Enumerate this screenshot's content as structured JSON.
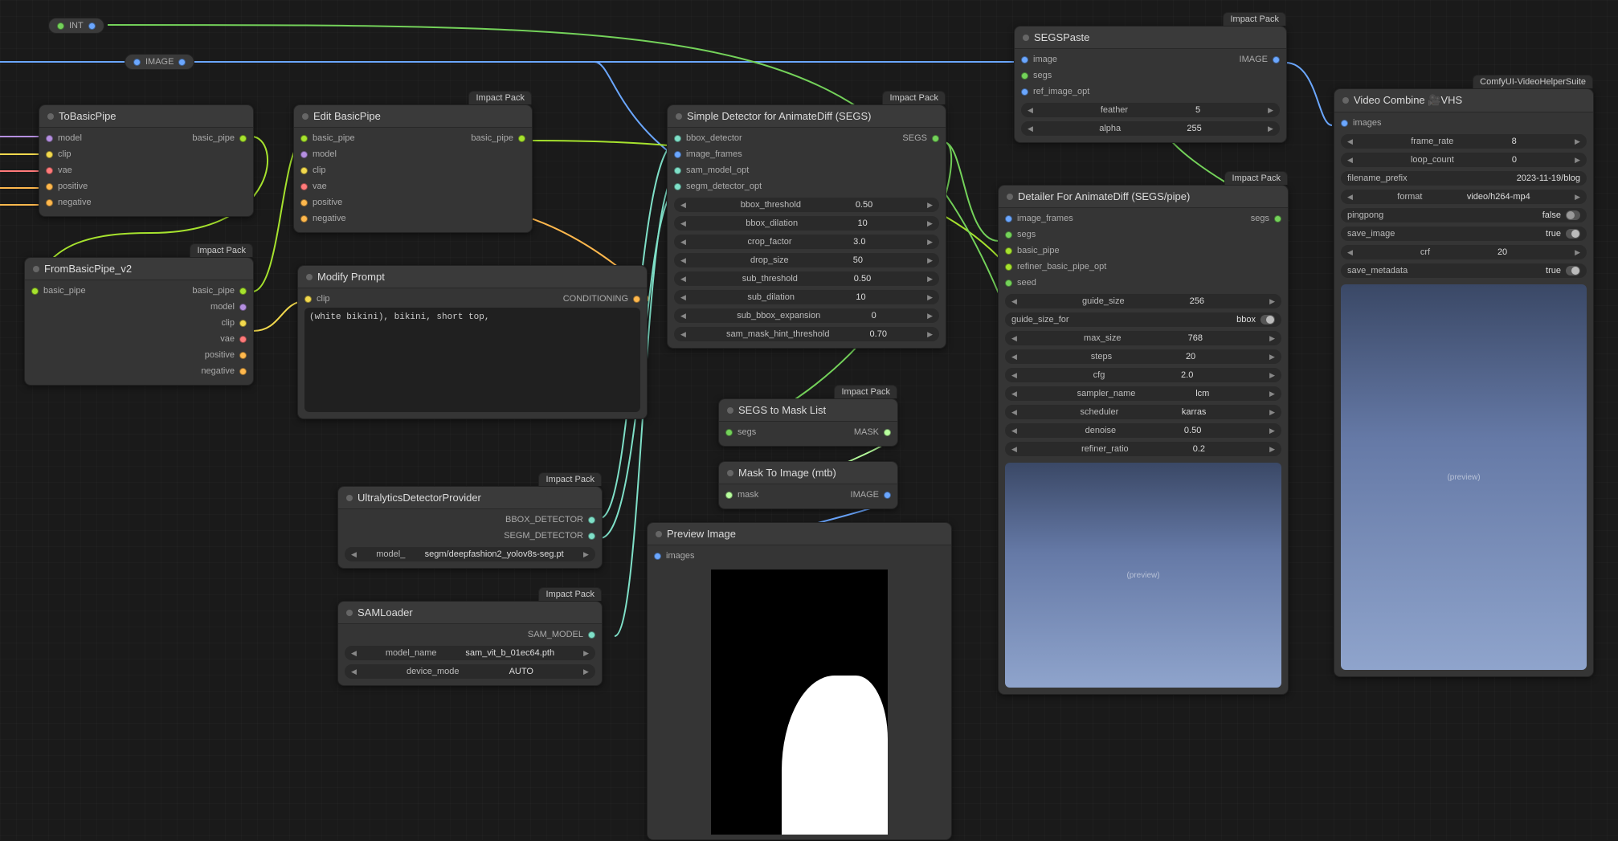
{
  "pill_int": {
    "label": "INT"
  },
  "image_badge": "IMAGE",
  "badges": {
    "impact": "Impact Pack",
    "vhs": "ComfyUI-VideoHelperSuite"
  },
  "nodes": {
    "tobasicpipe": {
      "title": "ToBasicPipe",
      "inputs": [
        "model",
        "clip",
        "vae",
        "positive",
        "negative"
      ],
      "outputs": [
        "basic_pipe"
      ]
    },
    "frombasicpipe": {
      "title": "FromBasicPipe_v2",
      "inputs": [
        "basic_pipe"
      ],
      "outputs": [
        "basic_pipe",
        "model",
        "clip",
        "vae",
        "positive",
        "negative"
      ]
    },
    "editbasicpipe": {
      "title": "Edit BasicPipe",
      "inputs": [
        "basic_pipe",
        "model",
        "clip",
        "vae",
        "positive",
        "negative"
      ],
      "outputs": [
        "basic_pipe"
      ]
    },
    "modifyprompt": {
      "title": "Modify Prompt",
      "inputs": [
        "clip"
      ],
      "outputs": [
        "CONDITIONING"
      ],
      "text": "(white bikini), bikini, short top,"
    },
    "ultra": {
      "title": "UltralyticsDetectorProvider",
      "outputs": [
        "BBOX_DETECTOR",
        "SEGM_DETECTOR"
      ],
      "widget": {
        "label": "model_",
        "value": "segm/deepfashion2_yolov8s-seg.pt"
      }
    },
    "sam": {
      "title": "SAMLoader",
      "outputs": [
        "SAM_MODEL"
      ],
      "widgets": [
        {
          "label": "model_name",
          "value": "sam_vit_b_01ec64.pth"
        },
        {
          "label": "device_mode",
          "value": "AUTO"
        }
      ]
    },
    "detector": {
      "title": "Simple Detector for AnimateDiff (SEGS)",
      "inputs": [
        "bbox_detector",
        "image_frames",
        "sam_model_opt",
        "segm_detector_opt"
      ],
      "outputs": [
        "SEGS"
      ],
      "widgets": [
        {
          "label": "bbox_threshold",
          "value": "0.50"
        },
        {
          "label": "bbox_dilation",
          "value": "10"
        },
        {
          "label": "crop_factor",
          "value": "3.0"
        },
        {
          "label": "drop_size",
          "value": "50"
        },
        {
          "label": "sub_threshold",
          "value": "0.50"
        },
        {
          "label": "sub_dilation",
          "value": "10"
        },
        {
          "label": "sub_bbox_expansion",
          "value": "0"
        },
        {
          "label": "sam_mask_hint_threshold",
          "value": "0.70"
        }
      ]
    },
    "segs2mask": {
      "title": "SEGS to Mask List",
      "inputs": [
        "segs"
      ],
      "outputs": [
        "MASK"
      ]
    },
    "mask2image": {
      "title": "Mask To Image (mtb)",
      "inputs": [
        "mask"
      ],
      "outputs": [
        "IMAGE"
      ]
    },
    "preview": {
      "title": "Preview Image",
      "inputs": [
        "images"
      ]
    },
    "segspaste": {
      "title": "SEGSPaste",
      "inputs": [
        "image",
        "segs",
        "ref_image_opt"
      ],
      "outputs": [
        "IMAGE"
      ],
      "widgets": [
        {
          "label": "feather",
          "value": "5"
        },
        {
          "label": "alpha",
          "value": "255"
        }
      ]
    },
    "detailer": {
      "title": "Detailer For AnimateDiff (SEGS/pipe)",
      "inputs": [
        "image_frames",
        "segs",
        "basic_pipe",
        "refiner_basic_pipe_opt",
        "seed"
      ],
      "outputs": [
        "segs"
      ],
      "widgets": [
        {
          "label": "guide_size",
          "value": "256"
        },
        {
          "label": "guide_size_for",
          "value": "bbox",
          "toggle": true
        },
        {
          "label": "max_size",
          "value": "768"
        },
        {
          "label": "steps",
          "value": "20"
        },
        {
          "label": "cfg",
          "value": "2.0"
        },
        {
          "label": "sampler_name",
          "value": "lcm"
        },
        {
          "label": "scheduler",
          "value": "karras"
        },
        {
          "label": "denoise",
          "value": "0.50"
        },
        {
          "label": "refiner_ratio",
          "value": "0.2"
        }
      ]
    },
    "video": {
      "title": "Video Combine 🎥VHS",
      "inputs": [
        "images"
      ],
      "widgets": [
        {
          "label": "frame_rate",
          "value": "8"
        },
        {
          "label": "loop_count",
          "value": "0"
        },
        {
          "label": "filename_prefix",
          "value": "2023-11-19/blog",
          "plain": true
        },
        {
          "label": "format",
          "value": "video/h264-mp4"
        },
        {
          "label": "pingpong",
          "value": "false",
          "toggle": true,
          "toggleOn": false
        },
        {
          "label": "save_image",
          "value": "true",
          "toggle": true,
          "toggleOn": true
        },
        {
          "label": "crf",
          "value": "20"
        },
        {
          "label": "save_metadata",
          "value": "true",
          "toggle": true,
          "toggleOn": true
        }
      ]
    }
  },
  "colors": {
    "model": "#b58fe0",
    "clip": "#f2d94e",
    "vae": "#ff7a7a",
    "conditioning": "#ffb84d",
    "basic_pipe": "#a6e22e",
    "image": "#6ba7ff",
    "segs": "#74d25a",
    "detector": "#7fe0c8",
    "sam": "#7fe0c8",
    "mask": "#b8ff9e",
    "int": "#74d25a"
  }
}
